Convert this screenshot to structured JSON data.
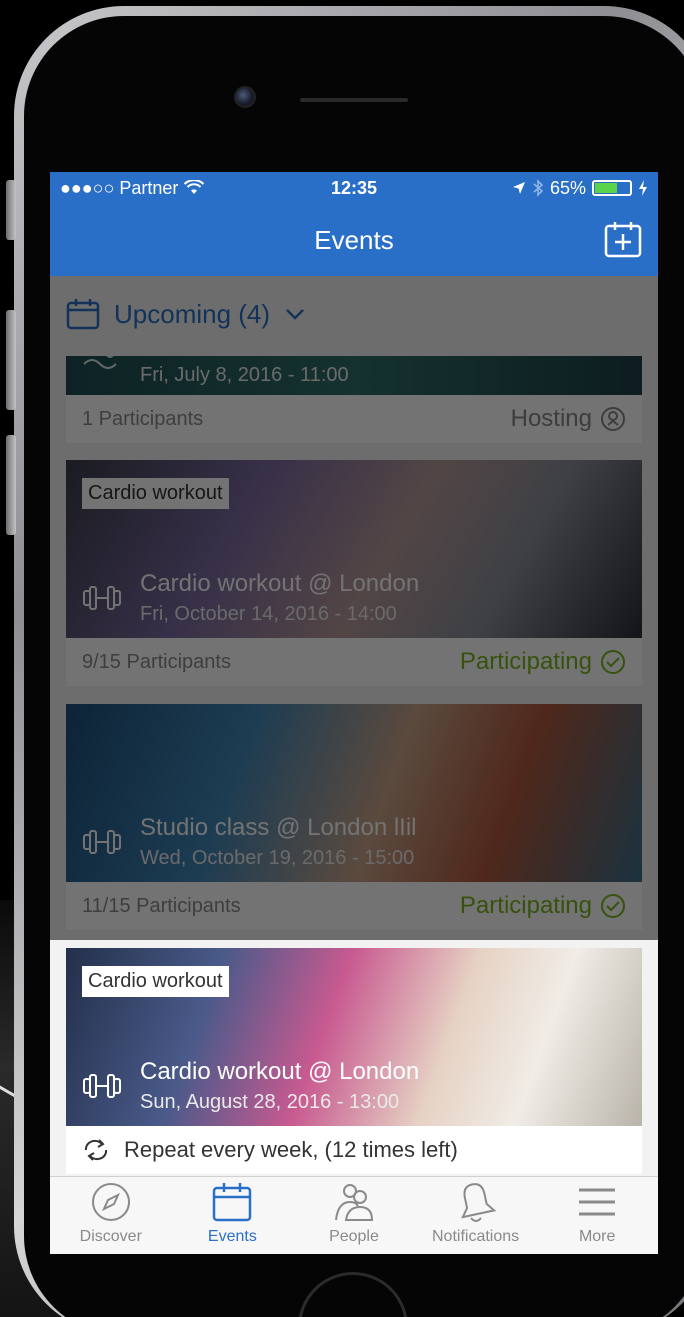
{
  "status_bar": {
    "carrier": "●●●○○ Partner",
    "time": "12:35",
    "battery": "65%"
  },
  "nav": {
    "title": "Events"
  },
  "filter": {
    "label": "Upcoming (4)"
  },
  "events": [
    {
      "tag": "",
      "title": "",
      "date": "Fri, July 8, 2016 - 11:00",
      "participants": "1 Participants",
      "status": "Hosting"
    },
    {
      "tag": "Cardio workout",
      "title": "Cardio workout @ London",
      "date": "Fri, October 14, 2016 - 14:00",
      "participants": "9/15 Participants",
      "status": "Participating"
    },
    {
      "tag": "",
      "title": "Studio class @ London lIil",
      "date": "Wed, October 19, 2016 - 15:00",
      "participants": "11/15 Participants",
      "status": "Participating"
    },
    {
      "tag": "Cardio workout",
      "title": "Cardio workout @ London",
      "date": "Sun, August 28, 2016 - 13:00",
      "repeat": "Repeat every week, (12 times left)"
    }
  ],
  "tabs": [
    {
      "label": "Discover",
      "icon": "compass-icon"
    },
    {
      "label": "Events",
      "icon": "calendar-icon"
    },
    {
      "label": "People",
      "icon": "people-icon"
    },
    {
      "label": "Notifications",
      "icon": "bell-icon"
    },
    {
      "label": "More",
      "icon": "menu-icon"
    }
  ],
  "colors": {
    "primary": "#2a6fc7",
    "participating": "#7ab51d"
  }
}
